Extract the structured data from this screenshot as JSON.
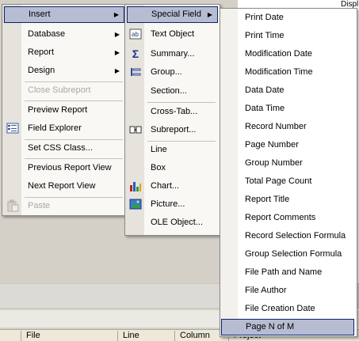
{
  "background": {
    "right_header": "Displ",
    "status_columns": [
      "File",
      "Line",
      "Column",
      "Project"
    ]
  },
  "main_menu": {
    "items": [
      {
        "label": "Insert",
        "submenu": true,
        "highlighted": true,
        "icon": ""
      },
      {
        "label": "Database",
        "submenu": true,
        "icon": ""
      },
      {
        "label": "Report",
        "submenu": true,
        "icon": ""
      },
      {
        "label": "Design",
        "submenu": true,
        "icon": ""
      },
      {
        "label": "Close Subreport",
        "disabled": true,
        "icon": ""
      },
      {
        "label": "Preview Report",
        "icon": ""
      },
      {
        "label": "Field Explorer",
        "icon": "field-explorer-icon"
      },
      {
        "label": "Set CSS Class...",
        "icon": ""
      },
      {
        "label": "Previous Report View",
        "icon": ""
      },
      {
        "label": "Next Report View",
        "icon": ""
      },
      {
        "label": "Paste",
        "disabled": true,
        "icon": "paste-icon"
      }
    ],
    "arrow_glyph": "▶"
  },
  "insert_menu": {
    "items": [
      {
        "label": "Special Field",
        "submenu": true,
        "highlighted": true,
        "icon": ""
      },
      {
        "label": "Text Object",
        "icon": "text-object-icon"
      },
      {
        "label": "Summary...",
        "icon": "sigma-icon"
      },
      {
        "label": "Group...",
        "icon": "group-icon"
      },
      {
        "label": "Section...",
        "icon": ""
      },
      {
        "label": "Cross-Tab...",
        "icon": ""
      },
      {
        "label": "Subreport...",
        "icon": "subreport-icon"
      },
      {
        "label": "Line",
        "icon": ""
      },
      {
        "label": "Box",
        "icon": ""
      },
      {
        "label": "Chart...",
        "icon": "chart-icon"
      },
      {
        "label": "Picture...",
        "icon": "picture-icon"
      },
      {
        "label": "OLE Object...",
        "icon": ""
      }
    ]
  },
  "special_field_menu": {
    "items": [
      "Print Date",
      "Print Time",
      "Modification Date",
      "Modification Time",
      "Data Date",
      "Data Time",
      "Record Number",
      "Page Number",
      "Group Number",
      "Total Page Count",
      "Report Title",
      "Report Comments",
      "Record Selection Formula",
      "Group Selection Formula",
      "File Path and Name",
      "File Author",
      "File Creation Date",
      "Page N of M"
    ],
    "highlighted_index": 17
  },
  "colors": {
    "highlight_fill": "#b6bdd2",
    "highlight_border": "#0a246a",
    "menu_bg": "#f9f8f4",
    "gutter": "#e5e3dc",
    "disabled_text": "#a8a8a8"
  }
}
